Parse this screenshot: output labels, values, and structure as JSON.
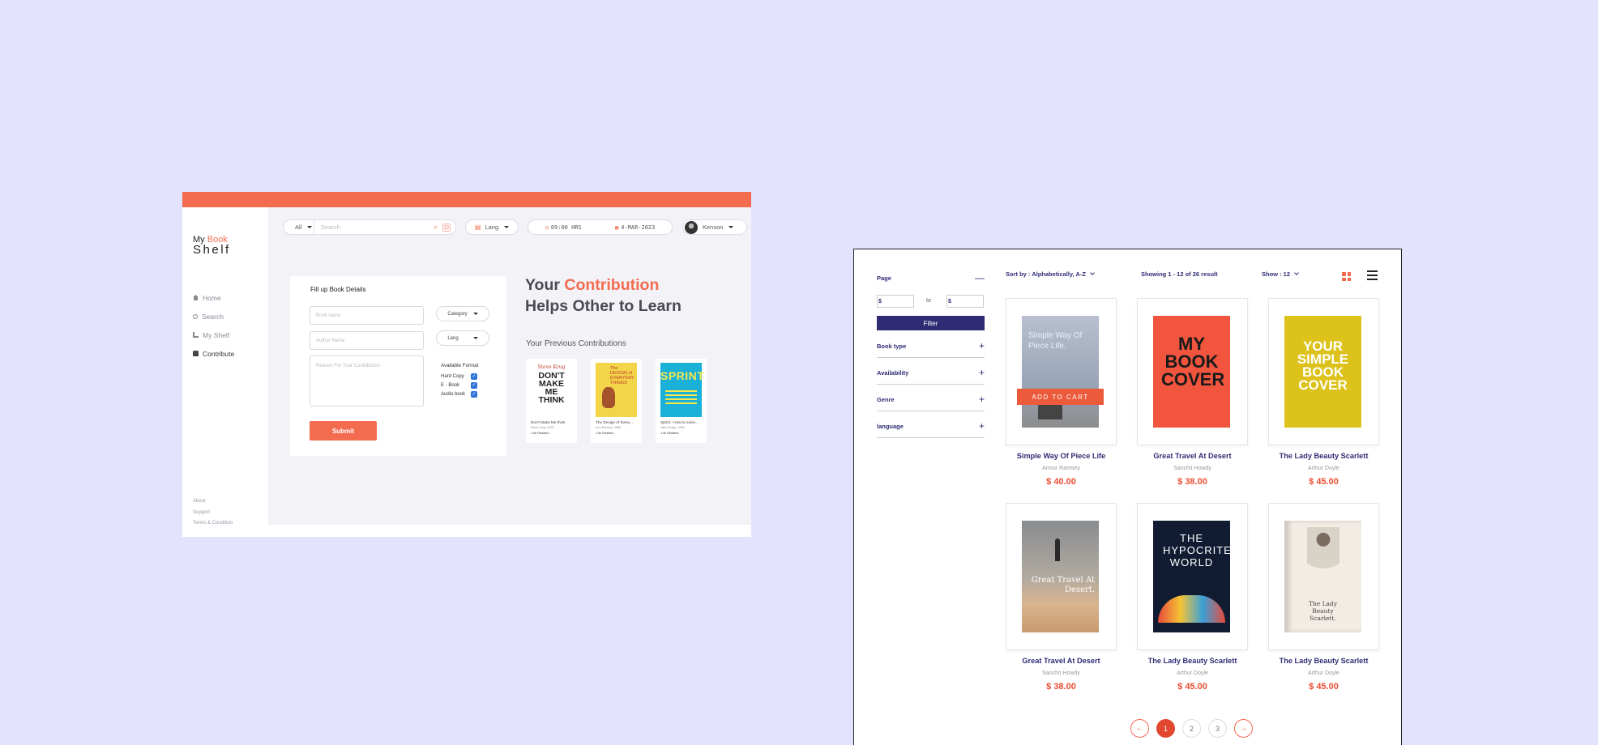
{
  "left_window": {
    "logo": {
      "word1": "My",
      "word2": "Book",
      "word3": "Shelf"
    },
    "nav": [
      {
        "label": "Home",
        "icon": "home-icon"
      },
      {
        "label": "Search",
        "icon": "search-icon"
      },
      {
        "label": "My Shelf",
        "icon": "shelf-icon"
      },
      {
        "label": "Contribute",
        "icon": "contribute-icon"
      }
    ],
    "footer_links": [
      "About",
      "Support",
      "Terms & Condition"
    ],
    "search": {
      "filter": "All",
      "placeholder": "Search"
    },
    "lang_select": "Lang",
    "time": "09:00 HRS",
    "date": "4-MAR-2023",
    "user": "Kenson",
    "form": {
      "title": "Fill up Book Details",
      "book_name_placeholder": "Book name",
      "author_placeholder": "Author Name",
      "reason_placeholder": "Reason For Your Contribution",
      "category": "Category",
      "lang": "Lang",
      "formats_title": "Available Format",
      "formats": [
        "Hard Copy",
        "E - Book",
        "Audio book"
      ],
      "submit": "Submit"
    },
    "hero": {
      "line1_a": "Your",
      "line1_b": "Contribution",
      "line2": "Helps Other to Learn"
    },
    "prev_title": "Your Previous Contributions",
    "prev_books": [
      {
        "title": "Don't Make Me think",
        "author": "Steve Krug, 2000",
        "readers": "1.9k Readers",
        "cover_top": "Steve Krug",
        "cover_main": "DON'T MAKE ME THINK"
      },
      {
        "title": "The Design of Every...",
        "author": "Don Norman, 1988",
        "readers": "1.9k Readers",
        "cover_top": "The DESIGN of EVERYDAY THINGS",
        "cover_main": ""
      },
      {
        "title": "Sprint : How to solve...",
        "author": "Jake Knapp, 2000",
        "readers": "1.9k Readers",
        "cover_top": "SPRINT",
        "cover_main": ""
      }
    ]
  },
  "right_window": {
    "filters": {
      "page": "Page",
      "price_symbol": "$",
      "price_to": "to",
      "filter_button": "Filter",
      "groups": [
        "Book type",
        "Availability",
        "Genre",
        "language"
      ]
    },
    "sort": "Sort by : Alphabetically, A-Z",
    "showing": "Showing 1 - 12 of 26 result",
    "show": "Show : 12",
    "add_to_cart": "ADD TO CART",
    "products": [
      {
        "title": "Simple Way Of Piece Life",
        "author": "Armor Ramsey",
        "price": "$ 40.00",
        "cover_text": "Simple Way Of Piece Life."
      },
      {
        "title": "Great Travel At Desert",
        "author": "Sanchit Howdy",
        "price": "$ 38.00",
        "cover_text": "MY BOOK COVER"
      },
      {
        "title": "The Lady Beauty Scarlett",
        "author": "Arthur Doyle",
        "price": "$ 45.00",
        "cover_text": "YOUR SIMPLE BOOK COVER"
      },
      {
        "title": "Great Travel At Desert",
        "author": "Sanchit Howdy",
        "price": "$ 38.00",
        "cover_text": "Great Travel At Desert."
      },
      {
        "title": "The Lady Beauty Scarlett",
        "author": "Arthur Doyle",
        "price": "$ 45.00",
        "cover_text": "THE HYPOCRITE WORLD"
      },
      {
        "title": "The Lady Beauty Scarlett",
        "author": "Arthur Doyle",
        "price": "$ 45.00",
        "cover_text": "The Lady Beauty Scarlett."
      }
    ],
    "pages": [
      "1",
      "2",
      "3"
    ],
    "accent_color": "#f36c50",
    "primary_color": "#2f2c74"
  }
}
